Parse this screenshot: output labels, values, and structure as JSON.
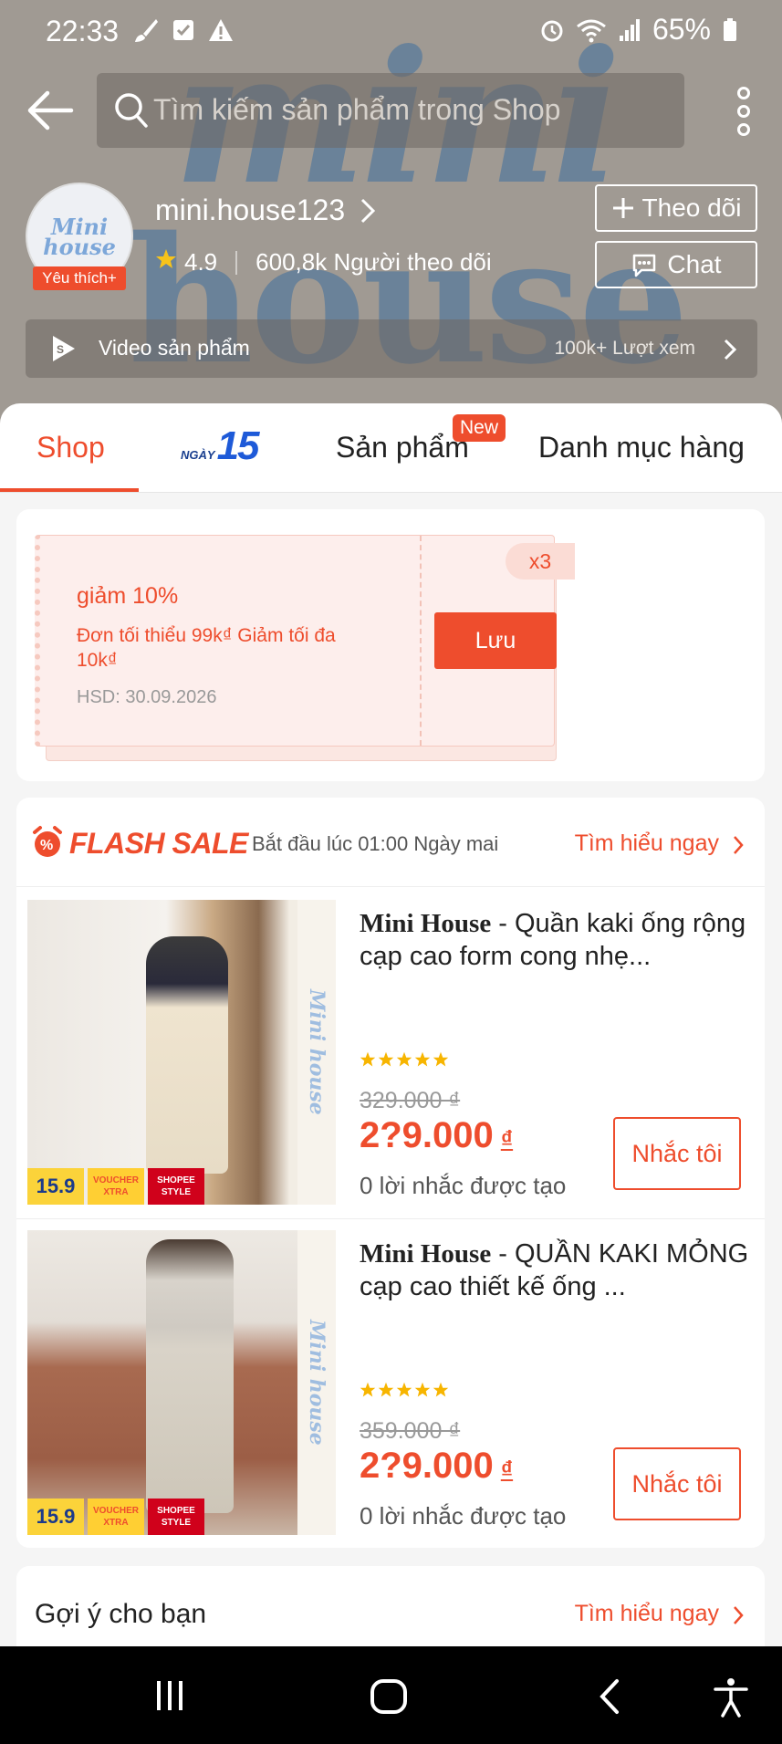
{
  "status_bar": {
    "time": "22:33",
    "battery": "65%"
  },
  "search": {
    "placeholder": "Tìm kiếm sản phẩm trong Shop"
  },
  "shop": {
    "avatar_text_1": "Mini",
    "avatar_text_2": "house",
    "favorite_badge": "Yêu thích+",
    "name": "mini.house123",
    "rating": "4.9",
    "followers": "600,8k Người theo dõi",
    "follow_label": "Theo dõi",
    "chat_label": "Chat",
    "watermark_1": "mini",
    "watermark_2": "house"
  },
  "video": {
    "label": "Video sản phẩm",
    "views": "100k+ Lượt xem"
  },
  "tabs": {
    "shop": "Shop",
    "day_prefix": "NGÀY",
    "day_number": "15",
    "products": "Sản phẩm",
    "new_badge": "New",
    "categories": "Danh mục hàng"
  },
  "voucher": {
    "title": "giảm 10%",
    "description": "Đơn tối thiểu 99k₫ Giảm tối đa 10k₫",
    "expiry": "HSD: 30.09.2026",
    "save_label": "Lưu",
    "quantity": "x3"
  },
  "flash_sale": {
    "title": "FLASH SALE",
    "start": "Bắt đầu lúc 01:00 Ngày mai",
    "learn_more": "Tìm hiểu ngay"
  },
  "products": [
    {
      "brand": "Mini House",
      "title": " - Quần kaki ống rộng cạp cao form cong nhẹ...",
      "old_price": "329.000 ₫",
      "price": "2?9.000",
      "currency": "₫",
      "reminders": "0 lời nhắc được tạo",
      "remind_label": "Nhắc tôi",
      "image_strip": "Mini house",
      "badge_159": "15.9",
      "badge_voucher": "VOUCHER XTRA",
      "badge_style": "SHOPEE STYLE",
      "rating_stars": 5
    },
    {
      "brand": "Mini House",
      "title": " - QUẦN KAKI MỎNG cạp cao thiết kế ống ...",
      "old_price": "359.000 ₫",
      "price": "2?9.000",
      "currency": "₫",
      "reminders": "0 lời nhắc được tạo",
      "remind_label": "Nhắc tôi",
      "image_strip": "Mini house",
      "badge_159": "15.9",
      "badge_voucher": "VOUCHER XTRA",
      "badge_style": "SHOPEE STYLE",
      "rating_stars": 5
    }
  ],
  "suggestions": {
    "title": "Gợi ý cho bạn",
    "learn_more": "Tìm hiểu ngay"
  },
  "colors": {
    "accent": "#ee4d2d",
    "header_bg": "#a09a93",
    "watermark": "#3f6f9e"
  },
  "icons": {
    "back": "arrow-left-icon",
    "search": "search-icon",
    "more": "more-vert-icon",
    "video": "play-badge-icon",
    "star": "star-icon",
    "flash": "alarm-clock-icon",
    "nav_recent": "recent-apps-icon",
    "nav_home": "home-icon",
    "nav_back": "back-icon",
    "nav_accessibility": "accessibility-icon"
  }
}
